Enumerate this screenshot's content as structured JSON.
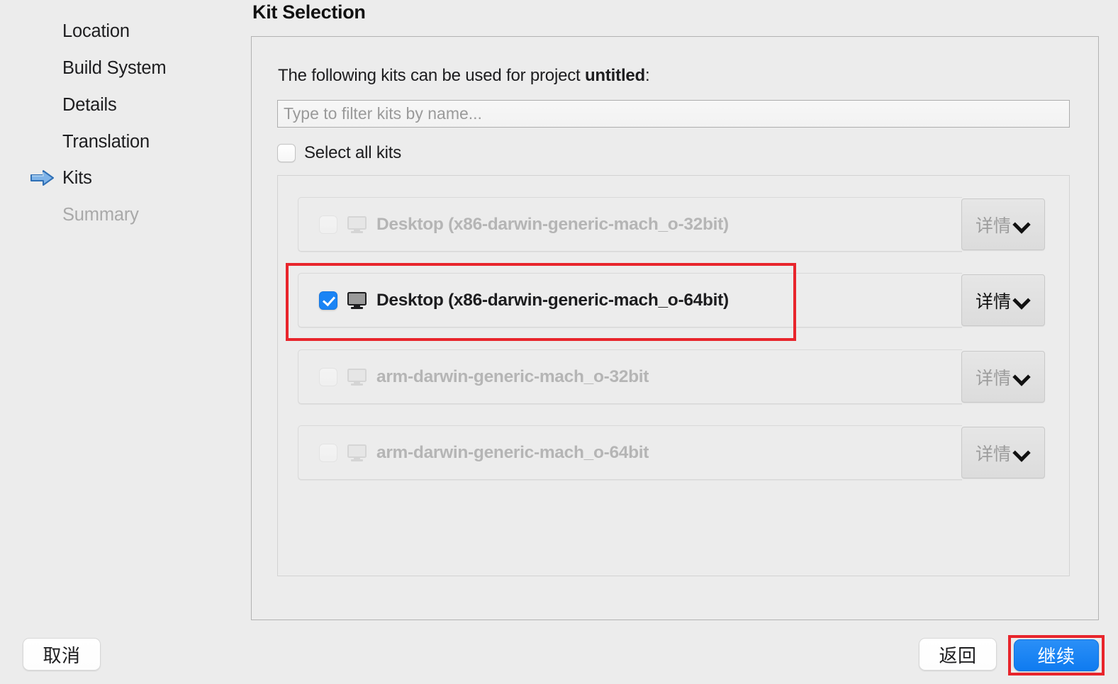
{
  "sidebar": {
    "items": [
      {
        "label": "Location",
        "state": "done",
        "icon": null
      },
      {
        "label": "Build System",
        "state": "done",
        "icon": null
      },
      {
        "label": "Details",
        "state": "done",
        "icon": null
      },
      {
        "label": "Translation",
        "state": "done",
        "icon": null
      },
      {
        "label": "Kits",
        "state": "current",
        "icon": "blue-arrow-icon"
      },
      {
        "label": "Summary",
        "state": "pending",
        "icon": null
      }
    ]
  },
  "main": {
    "title": "Kit Selection",
    "intro_prefix": "The following kits can be used for project ",
    "intro_project": "untitled",
    "intro_suffix": ":",
    "filter": {
      "value": "",
      "placeholder": "Type to filter kits by name..."
    },
    "select_all": {
      "label": "Select all kits",
      "checked": false
    },
    "details_button_label": "详情",
    "kits": [
      {
        "name": "Desktop (x86-darwin-generic-mach_o-32bit)",
        "checked": false,
        "enabled": false,
        "icon": "monitor-icon"
      },
      {
        "name": "Desktop (x86-darwin-generic-mach_o-64bit)",
        "checked": true,
        "enabled": true,
        "icon": "monitor-icon"
      },
      {
        "name": "arm-darwin-generic-mach_o-32bit",
        "checked": false,
        "enabled": false,
        "icon": "monitor-icon"
      },
      {
        "name": "arm-darwin-generic-mach_o-64bit",
        "checked": false,
        "enabled": false,
        "icon": "monitor-icon"
      }
    ]
  },
  "footer": {
    "cancel_label": "取消",
    "back_label": "返回",
    "continue_label": "继续"
  },
  "colors": {
    "accent_blue": "#1a84f5",
    "annotation_red": "#e8252c",
    "window_bg": "#ececec",
    "text_primary": "#1d1d1f",
    "text_disabled": "#b5b5b5"
  }
}
